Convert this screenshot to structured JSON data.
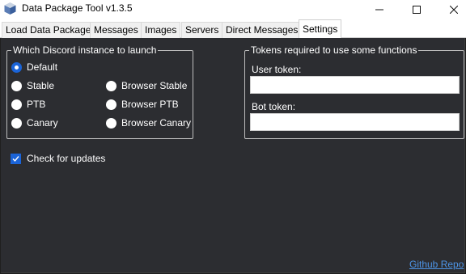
{
  "window": {
    "title": "Data Package Tool v1.3.5",
    "icon": "app-cube-icon"
  },
  "tabs": [
    {
      "label": "Load Data Package",
      "active": false
    },
    {
      "label": "Messages",
      "active": false
    },
    {
      "label": "Images",
      "active": false
    },
    {
      "label": "Servers",
      "active": false
    },
    {
      "label": "Direct Messages",
      "active": false
    },
    {
      "label": "Settings",
      "active": true
    }
  ],
  "instance_group": {
    "title": "Which Discord instance to launch",
    "options": [
      {
        "label": "Default",
        "checked": true
      },
      {
        "label": "Stable",
        "checked": false
      },
      {
        "label": "PTB",
        "checked": false
      },
      {
        "label": "Canary",
        "checked": false
      },
      {
        "label": "Browser Stable",
        "checked": false
      },
      {
        "label": "Browser PTB",
        "checked": false
      },
      {
        "label": "Browser Canary",
        "checked": false
      }
    ]
  },
  "tokens_group": {
    "title": "Tokens required to use some functions",
    "user_token_label": "User token:",
    "user_token_value": "",
    "bot_token_label": "Bot token:",
    "bot_token_value": ""
  },
  "updates": {
    "label": "Check for updates",
    "checked": true
  },
  "github_link": "Github Repo",
  "colors": {
    "accent": "#1b64d8",
    "background": "#2c2d31",
    "link": "#4d94e6"
  }
}
